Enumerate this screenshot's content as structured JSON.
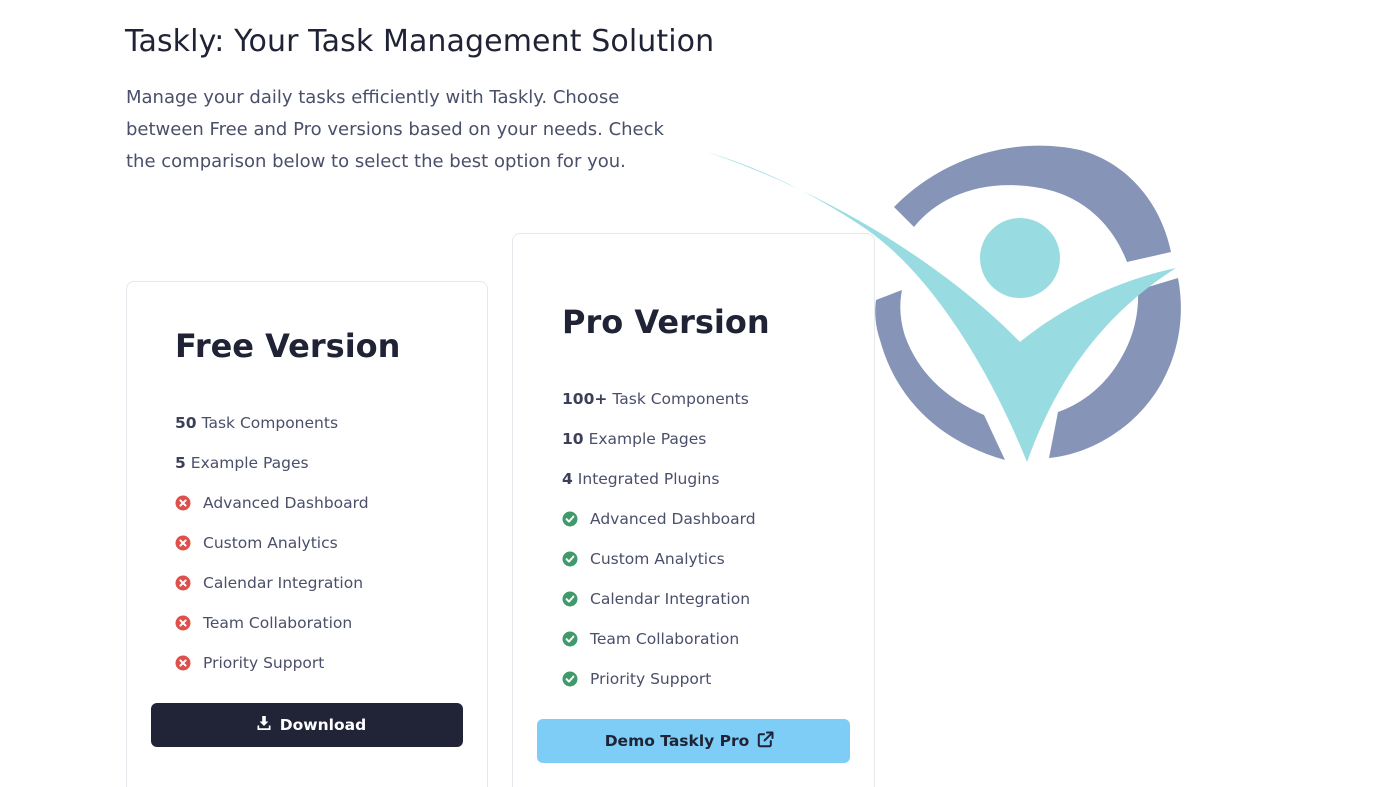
{
  "hero": {
    "title": "Taskly: Your Task Management Solution",
    "intro": "Manage your daily tasks efficiently with Taskly. Choose between Free and Pro versions based on your needs. Check the comparison below to select the best option for you."
  },
  "free": {
    "title": "Free Version",
    "features": [
      {
        "num": "50",
        "text": "Task Components"
      },
      {
        "num": "5",
        "text": "Example Pages"
      },
      {
        "icon": "x-circle-icon",
        "text": "Advanced Dashboard"
      },
      {
        "icon": "x-circle-icon",
        "text": "Custom Analytics"
      },
      {
        "icon": "x-circle-icon",
        "text": "Calendar Integration"
      },
      {
        "icon": "x-circle-icon",
        "text": "Team Collaboration"
      },
      {
        "icon": "x-circle-icon",
        "text": "Priority Support"
      }
    ],
    "button_label": "Download"
  },
  "pro": {
    "title": "Pro Version",
    "features": [
      {
        "num": "100+",
        "text": "Task Components"
      },
      {
        "num": "10",
        "text": "Example Pages"
      },
      {
        "num": "4",
        "text": "Integrated Plugins"
      },
      {
        "icon": "check-circle-icon",
        "text": "Advanced Dashboard"
      },
      {
        "icon": "check-circle-icon",
        "text": "Custom Analytics"
      },
      {
        "icon": "check-circle-icon",
        "text": "Calendar Integration"
      },
      {
        "icon": "check-circle-icon",
        "text": "Team Collaboration"
      },
      {
        "icon": "check-circle-icon",
        "text": "Priority Support"
      }
    ],
    "button_label": "Demo Taskly Pro"
  },
  "colors": {
    "heading": "#1f2335",
    "text": "#4a4f6a",
    "x_icon": "#e0504a",
    "check_icon": "#3f9a6c",
    "download_bg": "#212437",
    "demo_bg": "#7dcdf7",
    "logo_ring": "#8594b7",
    "logo_accent": "#98dce2"
  },
  "icons": {
    "logo": "taskly-logo-icon",
    "download": "download-icon",
    "external": "external-link-icon"
  }
}
